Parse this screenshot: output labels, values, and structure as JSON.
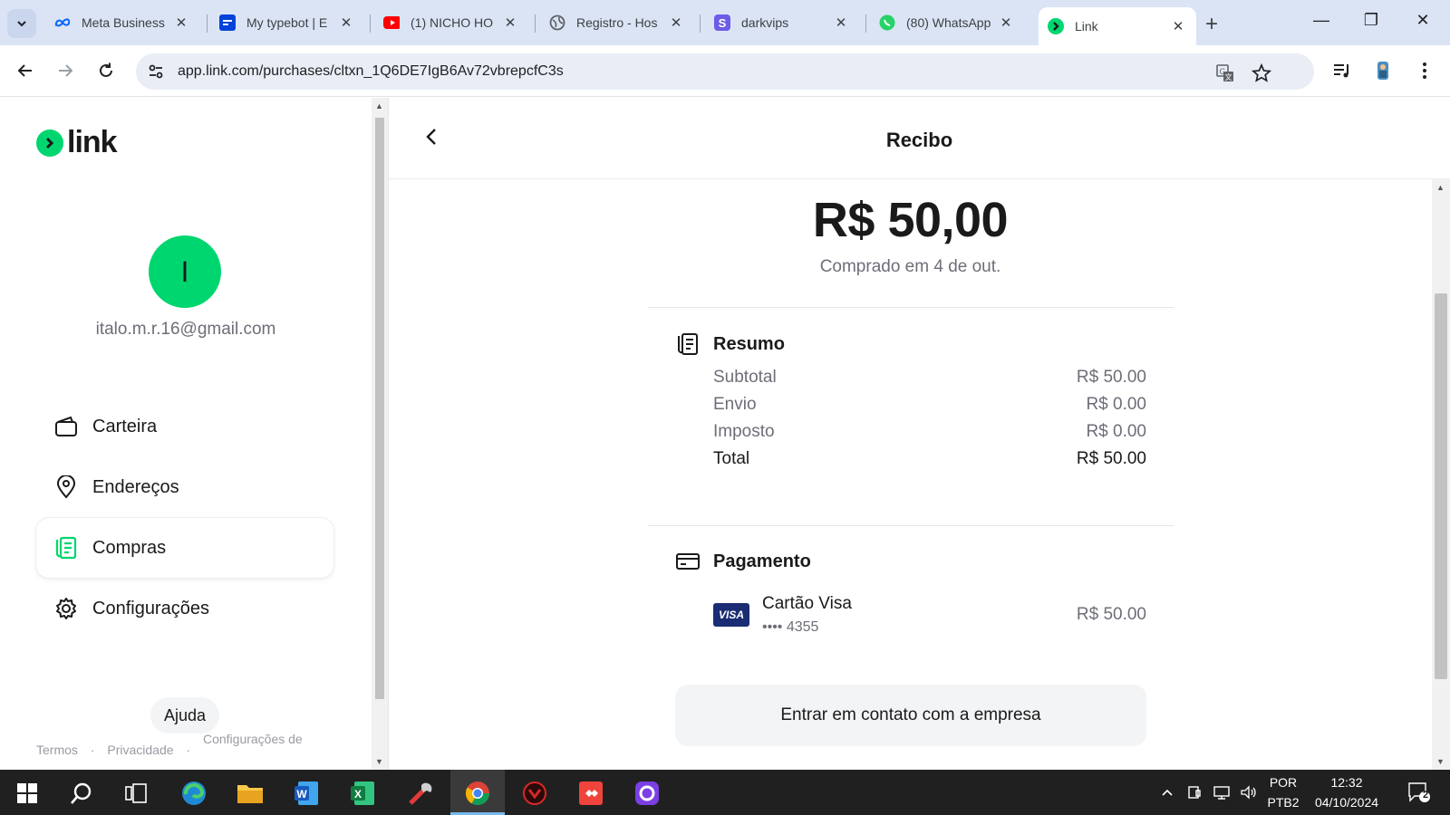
{
  "browser": {
    "tabs": [
      {
        "title": "Meta Business",
        "favicon": "meta-icon"
      },
      {
        "title": "My typebot | E",
        "favicon": "typebot-icon"
      },
      {
        "title": "(1) NICHO HO",
        "favicon": "youtube-icon"
      },
      {
        "title": "Registro - Hos",
        "favicon": "globe-icon"
      },
      {
        "title": "darkvips",
        "favicon": "s-icon"
      },
      {
        "title": "(80) WhatsApp",
        "favicon": "whatsapp-icon"
      },
      {
        "title": "Link",
        "favicon": "link-icon"
      }
    ],
    "url": "app.link.com/purchases/cltxn_1Q6DE7IgB6Av72vbrepcfC3s"
  },
  "sidebar": {
    "brand": "link",
    "avatar_initial": "I",
    "email": "italo.m.r.16@gmail.com",
    "nav": [
      {
        "label": "Carteira",
        "icon": "wallet-icon"
      },
      {
        "label": "Endereços",
        "icon": "location-pin-icon"
      },
      {
        "label": "Compras",
        "icon": "receipt-icon"
      },
      {
        "label": "Configurações",
        "icon": "gear-icon"
      }
    ],
    "active_nav": "Compras",
    "help": "Ajuda",
    "footer": {
      "terms": "Termos",
      "privacy": "Privacidade",
      "settings": "Configurações de"
    }
  },
  "receipt": {
    "title": "Recibo",
    "amount": "R$ 50,00",
    "purchased_on": "Comprado em 4 de out.",
    "summary_title": "Resumo",
    "summary": [
      {
        "label": "Subtotal",
        "value": "R$ 50.00"
      },
      {
        "label": "Envio",
        "value": "R$ 0.00"
      },
      {
        "label": "Imposto",
        "value": "R$ 0.00"
      },
      {
        "label": "Total",
        "value": "R$ 50.00"
      }
    ],
    "payment_title": "Pagamento",
    "card_brand": "VISA",
    "card_name": "Cartão Visa",
    "card_number": "•••• 4355",
    "card_amount": "R$ 50.00",
    "contact_button": "Entrar em contato com a empresa"
  },
  "taskbar": {
    "lang": "POR",
    "layout": "PTB2",
    "time": "12:32",
    "date": "04/10/2024",
    "notifications": "2"
  },
  "colors": {
    "brand_green": "#00d66f",
    "visa_blue": "#1a2d72"
  }
}
